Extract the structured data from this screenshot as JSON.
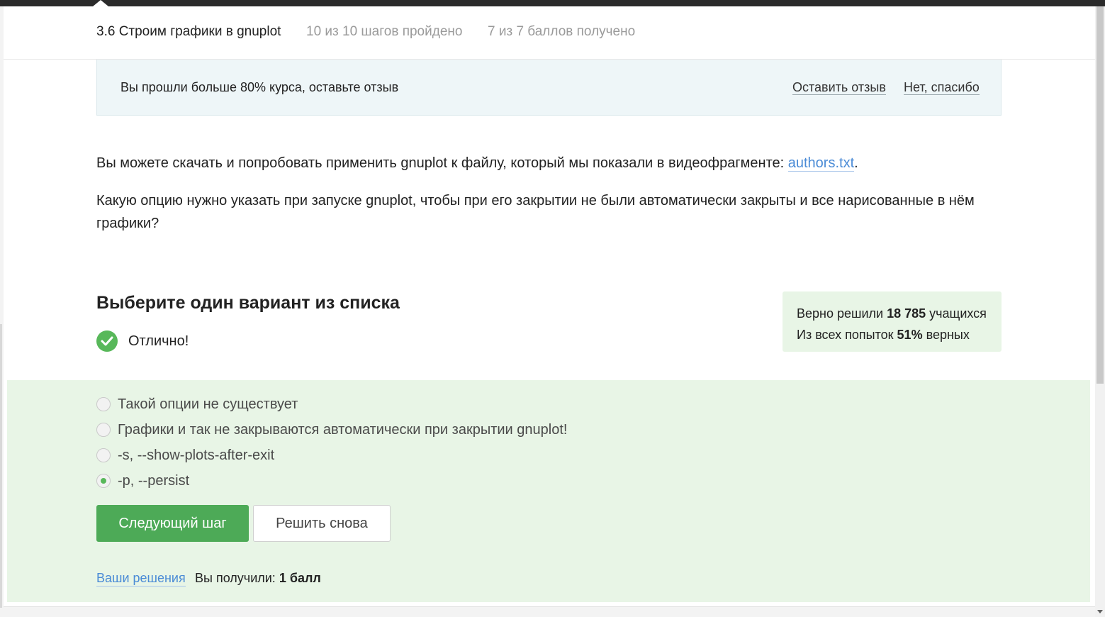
{
  "header": {
    "title": "3.6 Строим графики в gnuplot",
    "steps": "10 из 10 шагов пройдено",
    "points": "7 из 7 баллов  получено"
  },
  "feedback": {
    "message": "Вы прошли больше 80% курса, оставьте отзыв",
    "leave_label": "Оставить отзыв",
    "no_label": "Нет, спасибо"
  },
  "content": {
    "para1_text": "Вы можете скачать и попробовать применить gnuplot к файлу, который мы показали в видеофрагменте: ",
    "para1_link": "authors.txt",
    "para1_end": ".",
    "question": "Какую опцию нужно указать при запуске gnuplot, чтобы при его закрытии не были автоматически закрыты и все нарисованные в нём графики?"
  },
  "quiz": {
    "heading": "Выберите один вариант из списка",
    "result_label": "Отлично!",
    "stats_solved_prefix": "Верно решили ",
    "stats_solved_value": "18 785",
    "stats_solved_suffix": " учащихся",
    "stats_attempts_prefix": "Из всех попыток ",
    "stats_attempts_value": "51%",
    "stats_attempts_suffix": " верных",
    "options": [
      "Такой опции не существует",
      "Графики и так не закрываются автоматически при закрытии gnuplot!",
      "-s, --show-plots-after-exit",
      "-p, --persist"
    ],
    "selected_index": 3,
    "next_label": "Следующий шаг",
    "retry_label": "Решить снова",
    "solutions_label": "Ваши решения",
    "score_prefix": "Вы получили: ",
    "score_value": "1 балл"
  },
  "colors": {
    "accent_green": "#4daa57",
    "link_blue": "#4a8bd6",
    "answer_bg": "#e8f5e6",
    "feedback_bg": "#eef6f8"
  }
}
